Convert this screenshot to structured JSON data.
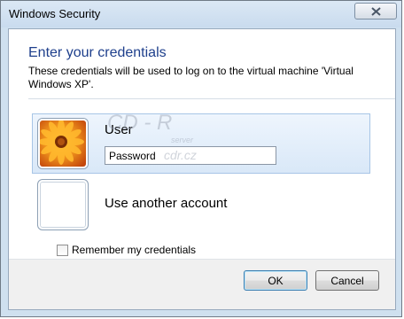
{
  "window": {
    "title": "Windows Security"
  },
  "dialog": {
    "heading": "Enter your credentials",
    "description": "These credentials will be used to log on to the virtual machine 'Virtual Windows XP'."
  },
  "accounts": {
    "selected": {
      "name": "User",
      "password_placeholder": "Password"
    },
    "other": {
      "label": "Use another account"
    }
  },
  "remember": {
    "label": "Remember my credentials",
    "checked": false
  },
  "buttons": {
    "ok": "OK",
    "cancel": "Cancel"
  },
  "watermark": {
    "main": "CD - R",
    "sub": "server",
    "url": "cdr.cz"
  },
  "colors": {
    "heading": "#1e3f8c",
    "selected_tile": "#d9e8f8",
    "window_frame": "#cfe0ef"
  },
  "icons": {
    "close": "close-icon",
    "user_avatar": "flower-avatar-icon",
    "other_avatar": "blank-avatar-icon"
  }
}
